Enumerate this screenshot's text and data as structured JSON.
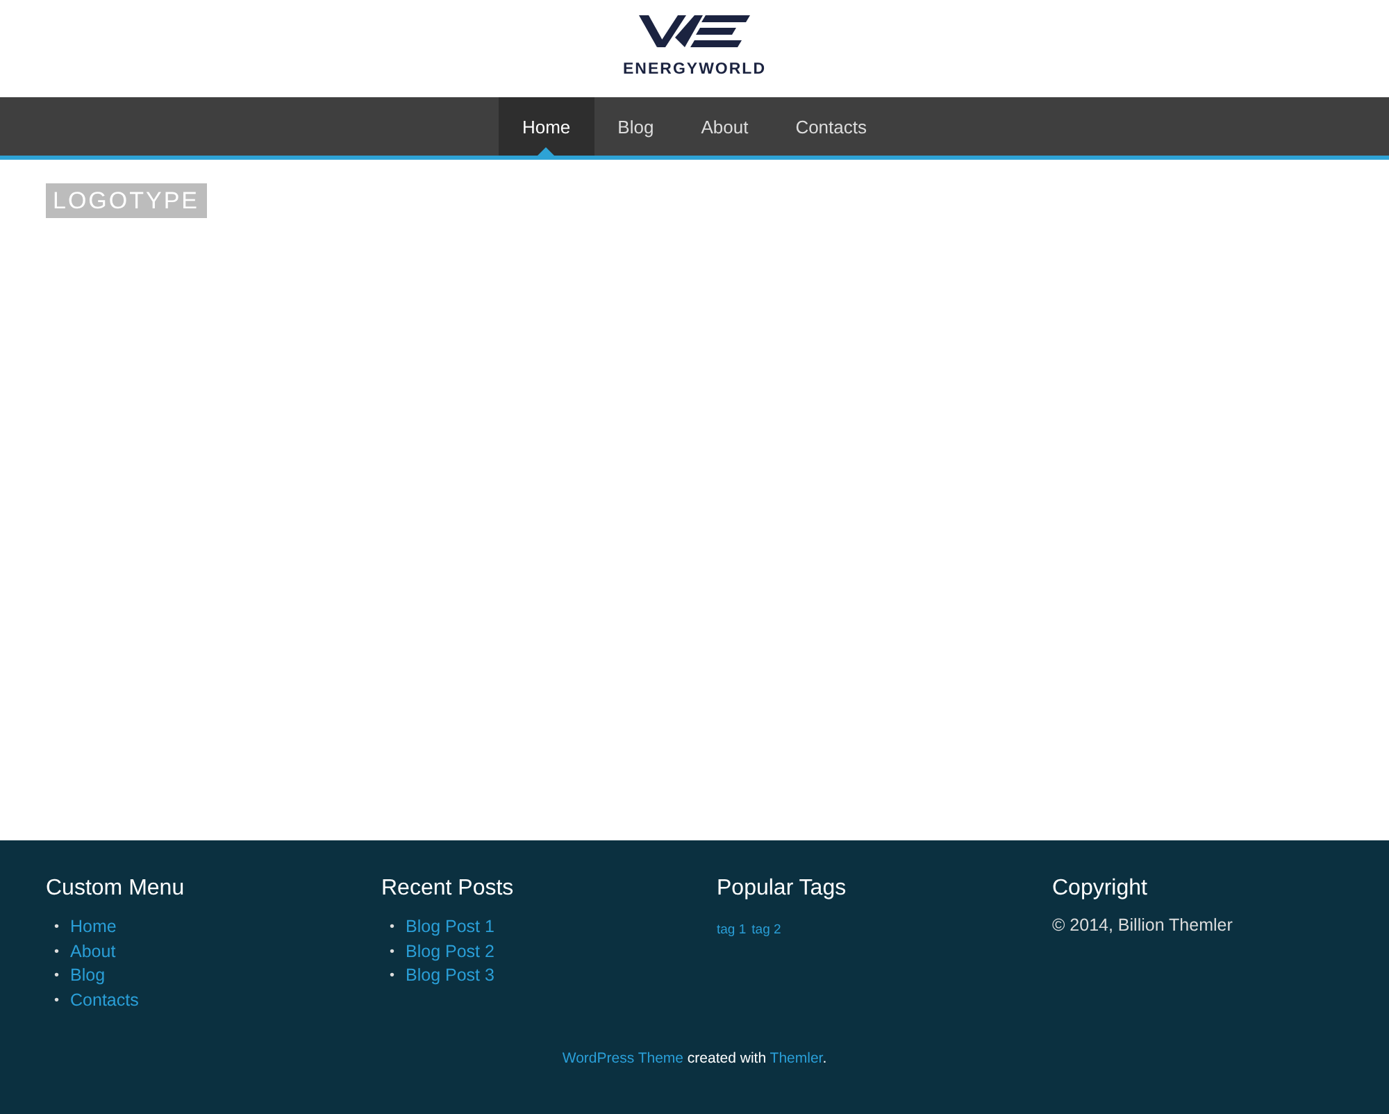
{
  "header": {
    "brand": "ENERGYWORLD"
  },
  "nav": [
    {
      "label": "Home",
      "selected": true
    },
    {
      "label": "Blog",
      "selected": false
    },
    {
      "label": "About",
      "selected": false
    },
    {
      "label": "Contacts",
      "selected": false
    }
  ],
  "content": {
    "logotype": "LOGOTYPE"
  },
  "footer": {
    "columns": [
      {
        "title": "Custom Menu",
        "kind": "list",
        "bullet": "•",
        "items": [
          "Home",
          "About",
          "Blog",
          "Contacts"
        ]
      },
      {
        "title": "Recent Posts",
        "kind": "list",
        "bullet": "•",
        "items": [
          "Blog Post 1",
          "Blog Post 2",
          "Blog Post 3"
        ]
      },
      {
        "title": "Popular Tags",
        "kind": "tags",
        "items": [
          "tag 1",
          "tag 2"
        ]
      },
      {
        "title": "Copyright",
        "kind": "text",
        "text": "© 2014, Billion Themler"
      }
    ],
    "credit": [
      {
        "kind": "link",
        "text": "WordPress Theme"
      },
      {
        "kind": "text",
        "text": " created with "
      },
      {
        "kind": "link",
        "text": "Themler"
      },
      {
        "kind": "text",
        "text": "."
      }
    ]
  }
}
